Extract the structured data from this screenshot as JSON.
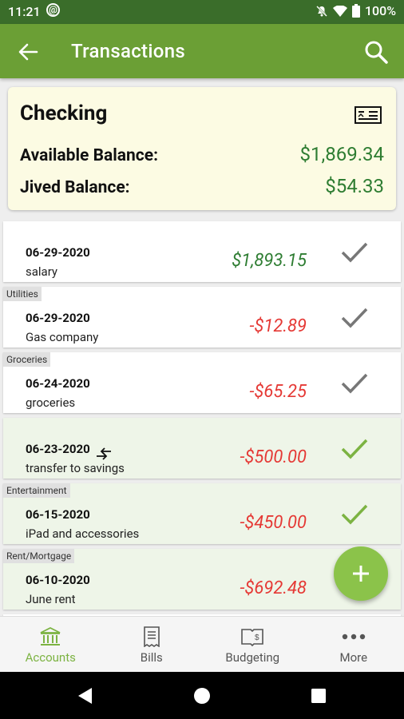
{
  "status": {
    "time": "11:21",
    "battery": "100%"
  },
  "app_bar": {
    "title": "Transactions"
  },
  "account": {
    "name": "Checking",
    "available_label": "Available Balance:",
    "available_value": "$1,869.34",
    "jived_label": "Jived Balance:",
    "jived_value": "$54.33"
  },
  "transactions": [
    {
      "category": "",
      "date": "06-29-2020",
      "description": "salary",
      "amount": "$1,893.15",
      "cleared": false
    },
    {
      "category": "Utilities",
      "date": "06-29-2020",
      "description": "Gas company",
      "amount": "-$12.89",
      "cleared": false
    },
    {
      "category": "Groceries",
      "date": "06-24-2020",
      "description": "groceries",
      "amount": "-$65.25",
      "cleared": false
    },
    {
      "category": "",
      "date": "06-23-2020",
      "description": "transfer to savings",
      "amount": "-$500.00",
      "cleared": true,
      "transfer": true
    },
    {
      "category": "Entertainment",
      "date": "06-15-2020",
      "description": "iPad and accessories",
      "amount": "-$450.00",
      "cleared": true
    },
    {
      "category": "Rent/Mortgage",
      "date": "06-10-2020",
      "description": "June rent",
      "amount": "-$692.48",
      "cleared": true
    }
  ],
  "colors": {
    "appbar": "#6b9f35",
    "positive": "#2e7d32",
    "negative": "#e53935",
    "cleared_check": "#7cb342",
    "pending_check": "#777777"
  },
  "bottom_nav": [
    {
      "label": "Accounts",
      "icon": "bank-icon",
      "active": true
    },
    {
      "label": "Bills",
      "icon": "bill-icon",
      "active": false
    },
    {
      "label": "Budgeting",
      "icon": "budget-book-icon",
      "active": false
    },
    {
      "label": "More",
      "icon": "more-dots-icon",
      "active": false
    }
  ]
}
